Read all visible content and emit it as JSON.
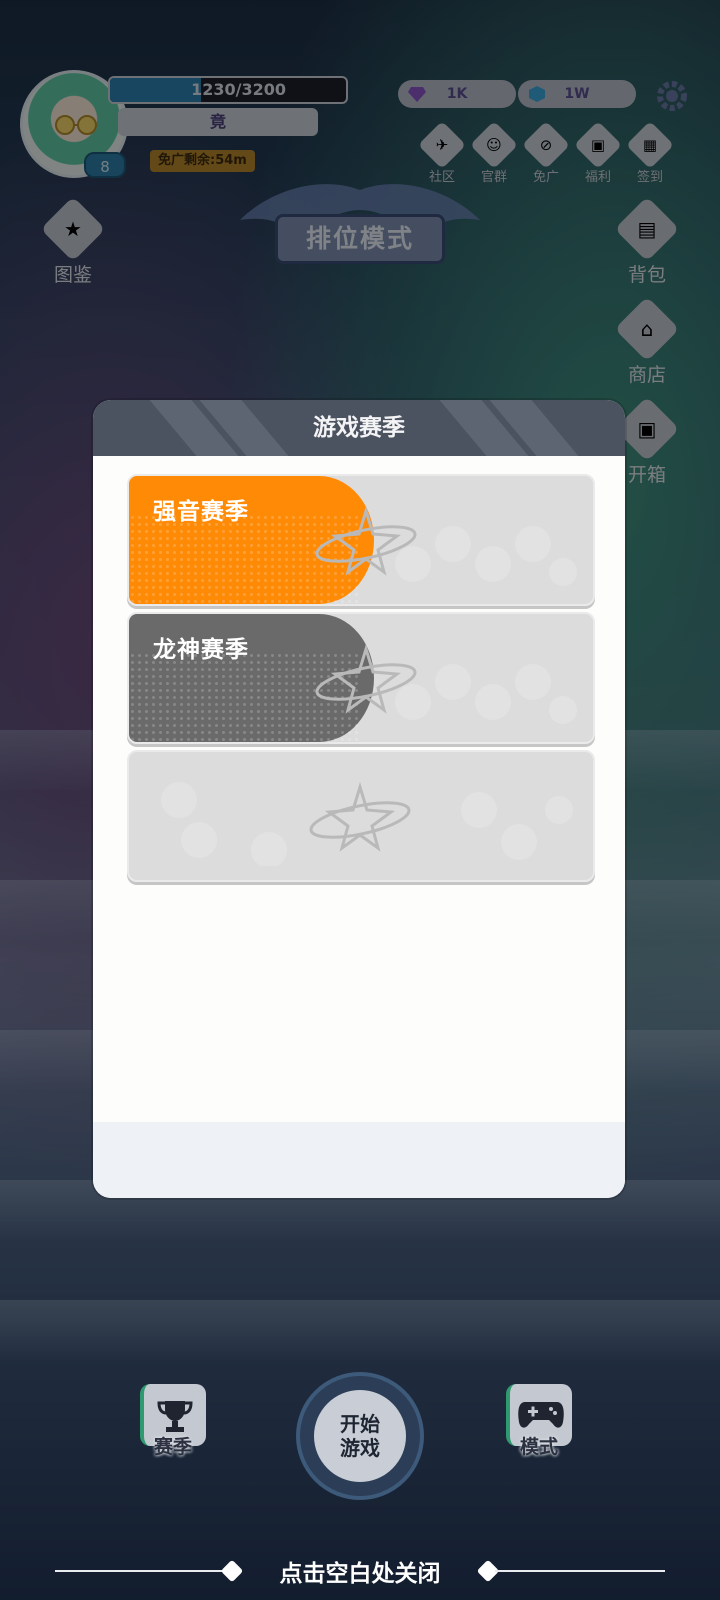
{
  "player": {
    "level": "8",
    "xp_text": "1230/3200",
    "xp_progress": 0.3844,
    "name": "竟",
    "adfree_remaining": "免广剩余:54m"
  },
  "currency": {
    "gems": "1K",
    "cubes": "1W"
  },
  "top_icons": [
    {
      "label": "社区",
      "icon": "paper-plane"
    },
    {
      "label": "官群",
      "icon": "group-chat"
    },
    {
      "label": "免广",
      "icon": "no-ads"
    },
    {
      "label": "福利",
      "icon": "treasure-chest"
    },
    {
      "label": "签到",
      "icon": "calendar"
    }
  ],
  "left_icons": [
    {
      "label": "图鉴",
      "icon": "book"
    }
  ],
  "right_icons": [
    {
      "label": "背包",
      "icon": "backpack"
    },
    {
      "label": "商店",
      "icon": "shop"
    },
    {
      "label": "开箱",
      "icon": "chest"
    }
  ],
  "mode": {
    "title": "排位模式"
  },
  "modal": {
    "title": "游戏赛季",
    "seasons": [
      {
        "name": "强音赛季",
        "style": "orange"
      },
      {
        "name": "龙神赛季",
        "style": "gray"
      },
      {
        "name": "",
        "style": "empty"
      }
    ]
  },
  "bottom_nav": {
    "season_label": "赛季",
    "start_line1": "开始",
    "start_line2": "游戏",
    "mode_label": "模式"
  },
  "close_hint": "点击空白处关闭",
  "colors": {
    "accent_orange": "#ff8a06",
    "card_gray": "#6a6a6b",
    "modal_header": "#4b5260"
  }
}
